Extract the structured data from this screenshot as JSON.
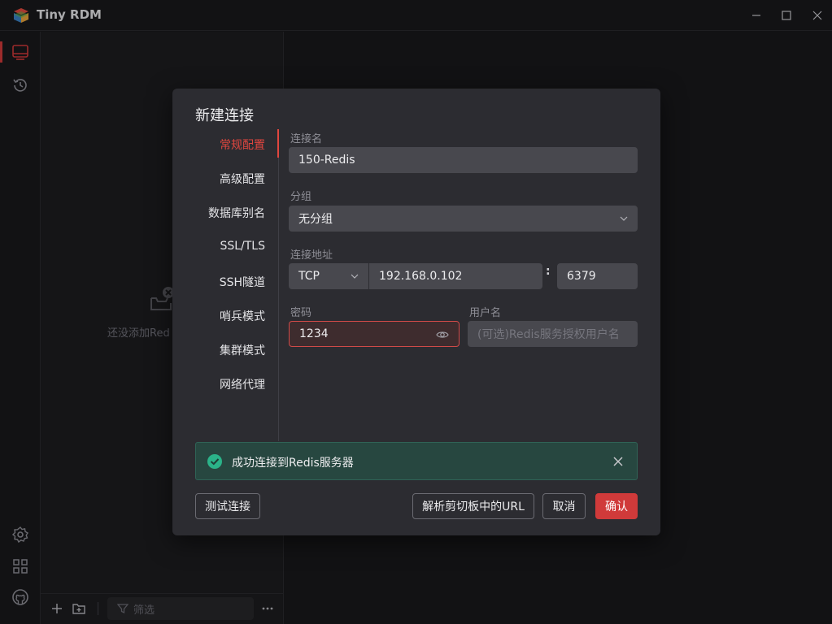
{
  "window": {
    "title": "Tiny RDM",
    "minimize_icon": "minimize-icon",
    "maximize_icon": "maximize-icon",
    "close_icon": "close-icon"
  },
  "ribbon": {
    "top_items": [
      {
        "icon": "server-icon",
        "active": true
      },
      {
        "icon": "history-icon",
        "active": false
      }
    ],
    "bottom_items": [
      {
        "icon": "settings-icon"
      },
      {
        "icon": "apps-grid-icon"
      },
      {
        "icon": "github-icon"
      }
    ]
  },
  "connection_pane": {
    "empty_text": "还没添加Red",
    "filter_placeholder": "筛选"
  },
  "dialog": {
    "title": "新建连接",
    "nav": [
      {
        "label": "常规配置",
        "active": true
      },
      {
        "label": "高级配置",
        "active": false
      },
      {
        "label": "数据库别名",
        "active": false
      },
      {
        "label": "SSL/TLS",
        "active": false
      },
      {
        "label": "SSH隧道",
        "active": false
      },
      {
        "label": "哨兵模式",
        "active": false
      },
      {
        "label": "集群模式",
        "active": false
      },
      {
        "label": "网络代理",
        "active": false
      }
    ],
    "fields": {
      "name_label": "连接名",
      "name_value": "150-Redis",
      "group_label": "分组",
      "group_value": "无分组",
      "address_label": "连接地址",
      "protocol_value": "TCP",
      "host_value": "192.168.0.102",
      "port_separator": ":",
      "port_value": "6379",
      "password_label": "密码",
      "password_value": "1234",
      "username_label": "用户名",
      "username_placeholder": "(可选)Redis服务授权用户名"
    },
    "alert": {
      "text": "成功连接到Redis服务器",
      "type": "success"
    },
    "buttons": {
      "test": "测试连接",
      "parse_url": "解析剪切板中的URL",
      "cancel": "取消",
      "confirm": "确认"
    }
  },
  "colors": {
    "accent": "#d03a3a",
    "success": "#2bb389",
    "background": "#18181b",
    "dialog": "#2c2c31"
  }
}
